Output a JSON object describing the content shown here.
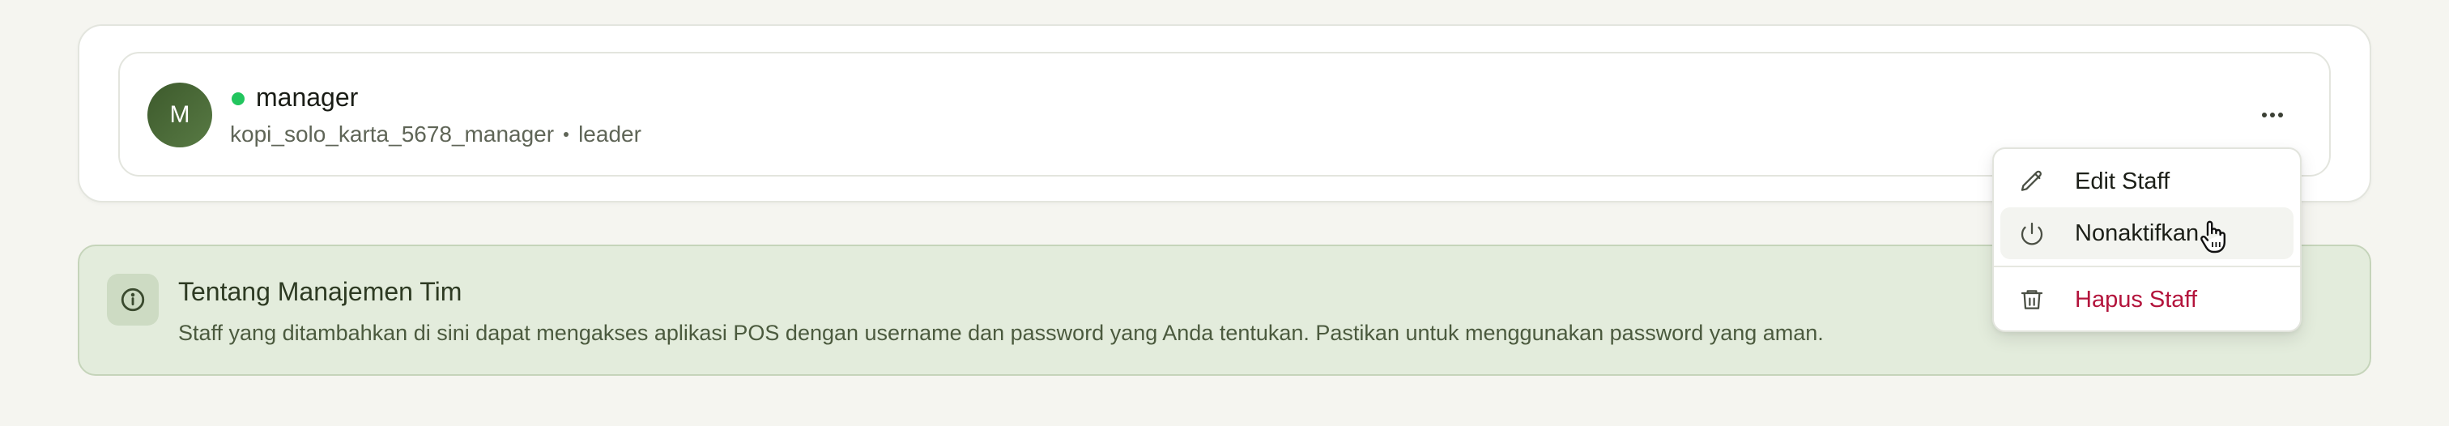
{
  "staff": {
    "avatar_initial": "M",
    "name": "manager",
    "username": "kopi_solo_karta_5678_manager",
    "role": "leader",
    "status_color": "#22c55e",
    "more_icon": "more-horizontal-icon"
  },
  "menu": {
    "items": [
      {
        "label": "Edit Staff",
        "icon": "pencil-icon"
      },
      {
        "label": "Nonaktifkan",
        "icon": "power-icon"
      },
      {
        "label": "Hapus Staff",
        "icon": "trash-icon",
        "color": "#b3143c"
      }
    ]
  },
  "info": {
    "icon": "info-icon",
    "title": "Tentang Manajemen Tim",
    "body": "Staff yang ditambahkan di sini dapat mengakses aplikasi POS dengan username dan password yang Anda tentukan. Pastikan untuk menggunakan password yang aman."
  }
}
